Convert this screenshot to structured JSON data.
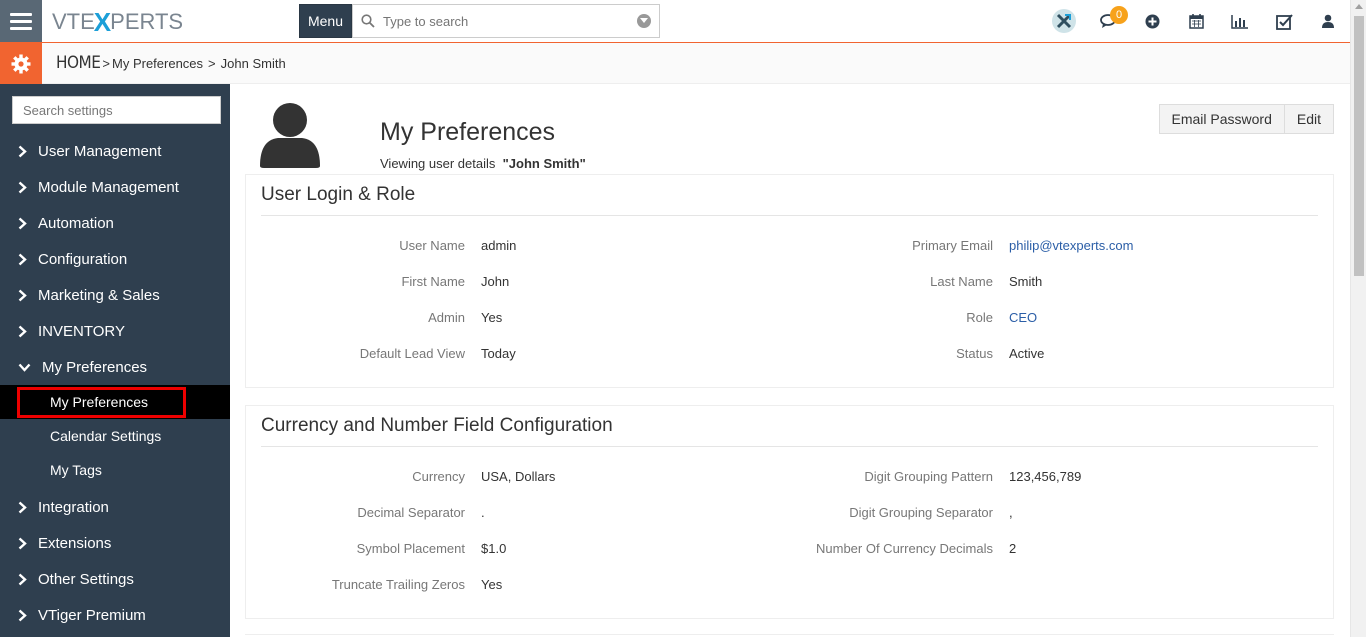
{
  "header": {
    "logo_left": "VTE",
    "logo_x": "X",
    "logo_right": "PERTS",
    "menu_label": "Menu",
    "search_placeholder": "Type to search",
    "notification_count": "0"
  },
  "breadcrumb": {
    "home": "HOME",
    "items": [
      "My Preferences",
      "John Smith"
    ],
    "separator": ">"
  },
  "sidebar": {
    "search_placeholder": "Search settings",
    "items": [
      {
        "label": "User Management",
        "expanded": false
      },
      {
        "label": "Module Management",
        "expanded": false
      },
      {
        "label": "Automation",
        "expanded": false
      },
      {
        "label": "Configuration",
        "expanded": false
      },
      {
        "label": "Marketing & Sales",
        "expanded": false
      },
      {
        "label": "INVENTORY",
        "expanded": false
      },
      {
        "label": "My Preferences",
        "expanded": true
      }
    ],
    "sub_items": [
      "My Preferences",
      "Calendar Settings",
      "My Tags"
    ],
    "items_after": [
      "Integration",
      "Extensions",
      "Other Settings",
      "VTiger Premium"
    ]
  },
  "page": {
    "title": "My Preferences",
    "subtitle_prefix": "Viewing user details",
    "subtitle_user": "\"John Smith\"",
    "email_password_label": "Email Password",
    "edit_label": "Edit"
  },
  "login_role": {
    "heading": "User Login & Role",
    "user_name_label": "User Name",
    "user_name": "admin",
    "primary_email_label": "Primary Email",
    "primary_email": "philip@vtexperts.com",
    "first_name_label": "First Name",
    "first_name": "John",
    "last_name_label": "Last Name",
    "last_name": "Smith",
    "admin_label": "Admin",
    "admin": "Yes",
    "role_label": "Role",
    "role": "CEO",
    "default_lead_view_label": "Default Lead View",
    "default_lead_view": "Today",
    "status_label": "Status",
    "status": "Active"
  },
  "currency": {
    "heading": "Currency and Number Field Configuration",
    "currency_label": "Currency",
    "currency": "USA, Dollars",
    "digit_grouping_pattern_label": "Digit Grouping Pattern",
    "digit_grouping_pattern": "123,456,789",
    "decimal_separator_label": "Decimal Separator",
    "decimal_separator": ".",
    "digit_grouping_separator_label": "Digit Grouping Separator",
    "digit_grouping_separator": ",",
    "symbol_placement_label": "Symbol Placement",
    "symbol_placement": "$1.0",
    "currency_decimals_label": "Number Of Currency Decimals",
    "currency_decimals": "2",
    "truncate_label": "Truncate Trailing Zeros",
    "truncate": "Yes"
  },
  "colors": {
    "accent": "#f16430",
    "sidebar_bg": "#2f3f4f",
    "link": "#2b5ea7",
    "badge": "#f7a21b"
  },
  "icons": [
    "hamburger-icon",
    "search-icon",
    "chevron-down-icon",
    "vtiger-x-icon",
    "chat-icon",
    "plus-circle-icon",
    "calendar-icon",
    "bar-chart-icon",
    "tasks-icon",
    "user-icon",
    "gear-icon",
    "chevron-right-icon",
    "avatar-icon"
  ]
}
